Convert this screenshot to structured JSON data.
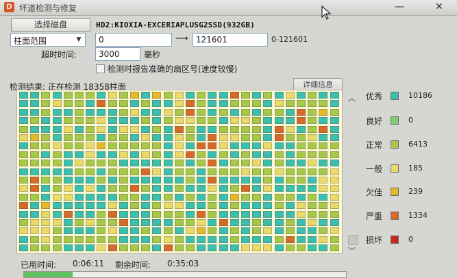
{
  "window": {
    "title": "坏道检测与修复",
    "app_icon": "D"
  },
  "toolbar": {
    "select_disk_label": "选择磁盘",
    "disk_name": "HD2:KIOXIA-EXCERIAPLUSG2SSD(932GB)"
  },
  "range": {
    "mode_value": "柱面范围",
    "start_value": "0",
    "end_value": "121601",
    "range_hint": "0-121601"
  },
  "timeout": {
    "label": "超时时间:",
    "value": "3000",
    "unit": "毫秒"
  },
  "option": {
    "label": "检测时报告准确的扇区号(速度较慢)"
  },
  "result": {
    "label": "检测结果:  正在检测  18358柱面",
    "detail_button": "详细信息"
  },
  "legend": [
    {
      "name": "优秀",
      "color": "#3cbfae",
      "count": "10186"
    },
    {
      "name": "良好",
      "color": "#7fcf6e",
      "count": "0"
    },
    {
      "name": "正常",
      "color": "#a8c84c",
      "count": "6413"
    },
    {
      "name": "一般",
      "color": "#ead96b",
      "count": "185"
    },
    {
      "name": "欠佳",
      "color": "#e3b92e",
      "count": "239"
    },
    {
      "name": "严重",
      "color": "#d56a2a",
      "count": "1334"
    },
    {
      "name": "损坏",
      "color": "#c8271c",
      "count": "0"
    }
  ],
  "times": {
    "elapsed_label": "已用时间:",
    "elapsed_value": "0:06:11",
    "remaining_label": "剩余时间:",
    "remaining_value": "0:35:03"
  },
  "progress_fraction": 0.15
}
